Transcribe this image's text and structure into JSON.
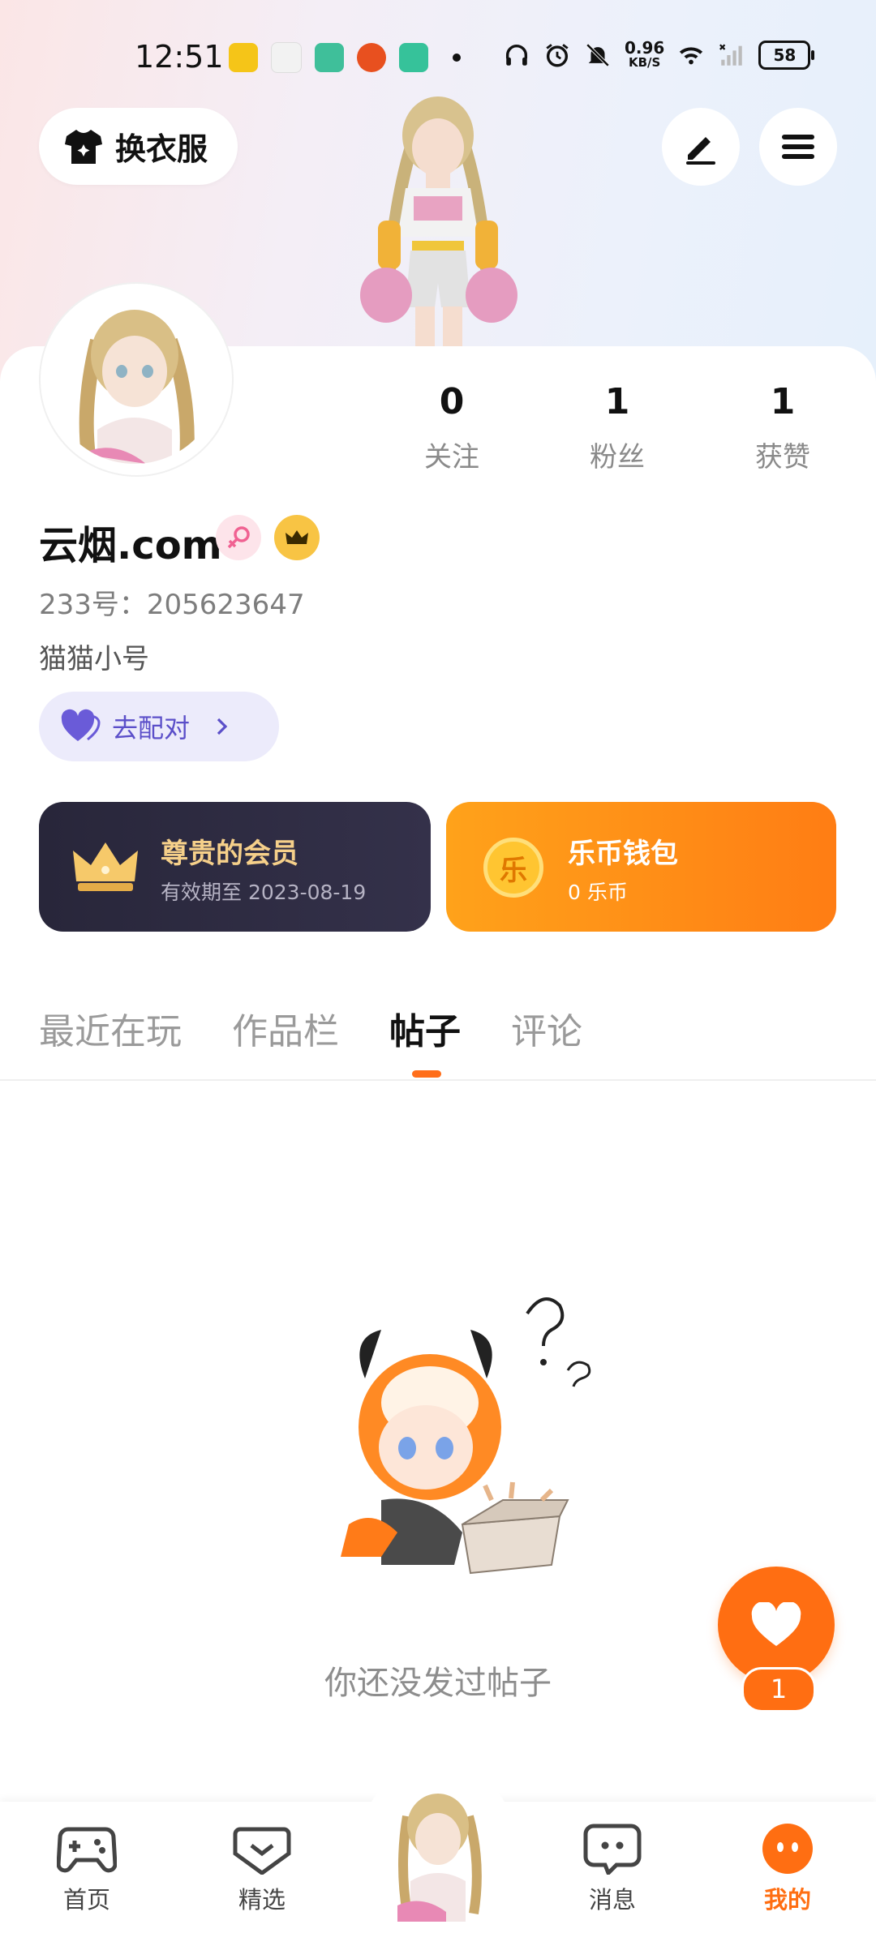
{
  "status_bar": {
    "time": "12:51",
    "net_speed_value": "0.96",
    "net_speed_unit": "KB/S",
    "battery": "58"
  },
  "header": {
    "outfit_label": "换衣服",
    "edit_icon": "pen-icon",
    "menu_icon": "menu-icon"
  },
  "profile": {
    "name": "云烟.com",
    "id_line": "233号：205623647",
    "bio": "猫猫小号",
    "match_label": "去配对",
    "stats": [
      {
        "value": "0",
        "label": "关注"
      },
      {
        "value": "1",
        "label": "粉丝"
      },
      {
        "value": "1",
        "label": "获赞"
      }
    ]
  },
  "vip_card": {
    "title": "尊贵的会员",
    "subtitle": "有效期至 2023-08-19",
    "icon_glyph": "👑"
  },
  "wallet_card": {
    "title": "乐币钱包",
    "subtitle": "0 乐币",
    "coin_glyph": "乐"
  },
  "tabs": [
    {
      "label": "最近在玩"
    },
    {
      "label": "作品栏"
    },
    {
      "label": "帖子"
    },
    {
      "label": "评论"
    }
  ],
  "empty_state": {
    "text": "你还没发过帖子"
  },
  "like_fab": {
    "count": "1"
  },
  "bottom_nav": [
    {
      "label": "首页",
      "icon": "gamepad-icon"
    },
    {
      "label": "精选",
      "icon": "heart-badge-icon"
    },
    {
      "label": "",
      "icon": "avatar"
    },
    {
      "label": "消息",
      "icon": "chat-icon"
    },
    {
      "label": "我的",
      "icon": "me-icon"
    }
  ],
  "colors": {
    "accent": "#ff6e12",
    "match_text": "#5b4fc9",
    "vip_gold": "#f6c96a",
    "card_dark": "#28263a"
  }
}
